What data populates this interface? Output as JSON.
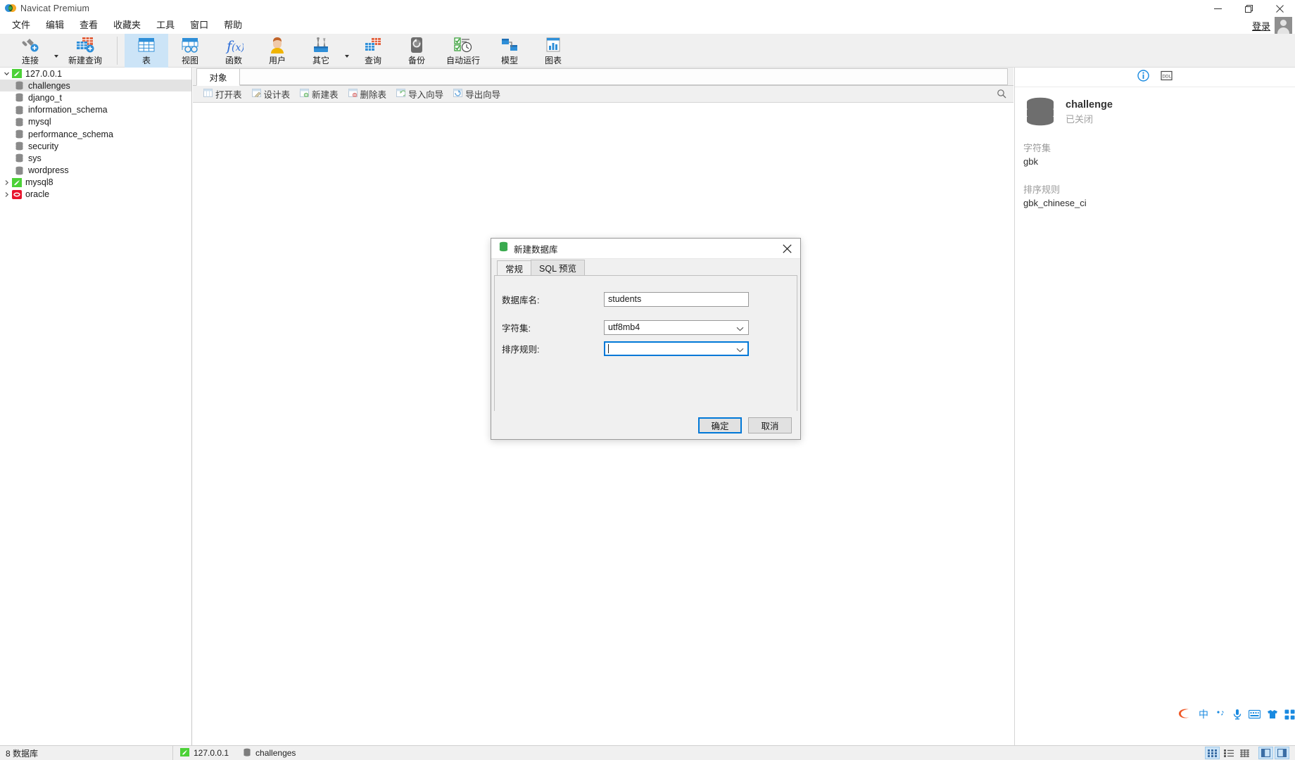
{
  "window": {
    "app_title": "Navicat Premium",
    "minimize": "—",
    "maximize": "❐",
    "close": "✕"
  },
  "menubar": {
    "items": [
      {
        "label": "文件"
      },
      {
        "label": "编辑"
      },
      {
        "label": "查看"
      },
      {
        "label": "收藏夹"
      },
      {
        "label": "工具"
      },
      {
        "label": "窗口"
      },
      {
        "label": "帮助"
      }
    ],
    "login_label": "登录"
  },
  "ribbon": {
    "items": [
      {
        "label": "连接",
        "icon": "connection-icon",
        "caret": true,
        "active": false
      },
      {
        "label": "新建查询",
        "icon": "new-query-icon",
        "caret": false,
        "active": false
      },
      {
        "label": "表",
        "icon": "table-icon",
        "caret": false,
        "active": true
      },
      {
        "label": "视图",
        "icon": "view-icon",
        "caret": false,
        "active": false
      },
      {
        "label": "函数",
        "icon": "function-icon",
        "caret": false,
        "active": false
      },
      {
        "label": "用户",
        "icon": "user-icon",
        "caret": false,
        "active": false
      },
      {
        "label": "其它",
        "icon": "other-tools-icon",
        "caret": true,
        "active": false
      },
      {
        "label": "查询",
        "icon": "query-icon",
        "caret": false,
        "active": false
      },
      {
        "label": "备份",
        "icon": "backup-icon",
        "caret": false,
        "active": false
      },
      {
        "label": "自动运行",
        "icon": "automation-icon",
        "caret": false,
        "active": false
      },
      {
        "label": "模型",
        "icon": "model-icon",
        "caret": false,
        "active": false
      },
      {
        "label": "图表",
        "icon": "chart-icon",
        "caret": false,
        "active": false
      }
    ]
  },
  "sidebar": {
    "connections": [
      {
        "label": "127.0.0.1",
        "icon": "mysql-connection-icon",
        "expanded": true,
        "databases": [
          {
            "label": "challenges",
            "selected": true
          },
          {
            "label": "django_t",
            "selected": false
          },
          {
            "label": "information_schema",
            "selected": false
          },
          {
            "label": "mysql",
            "selected": false
          },
          {
            "label": "performance_schema",
            "selected": false
          },
          {
            "label": "security",
            "selected": false
          },
          {
            "label": "sys",
            "selected": false
          },
          {
            "label": "wordpress",
            "selected": false
          }
        ]
      },
      {
        "label": "mysql8",
        "icon": "mysql-connection-icon",
        "expanded": false,
        "databases": []
      },
      {
        "label": "oracle",
        "icon": "oracle-connection-icon",
        "expanded": false,
        "databases": []
      }
    ]
  },
  "main": {
    "tab_label": "对象",
    "object_toolbar": [
      {
        "label": "打开表",
        "icon": "open-table-icon"
      },
      {
        "label": "设计表",
        "icon": "design-table-icon"
      },
      {
        "label": "新建表",
        "icon": "new-table-icon"
      },
      {
        "label": "删除表",
        "icon": "delete-table-icon"
      },
      {
        "label": "导入向导",
        "icon": "import-wizard-icon"
      },
      {
        "label": "导出向导",
        "icon": "export-wizard-icon"
      }
    ]
  },
  "rightpanel": {
    "info_icon": "info-icon",
    "ddl_icon": "ddl-icon",
    "db_name": "challenge",
    "db_status": "已关闭",
    "charset_label": "字符集",
    "charset_value": "gbk",
    "collation_label": "排序规则",
    "collation_value": "gbk_chinese_ci"
  },
  "dialog": {
    "title": "新建数据库",
    "icon": "database-icon",
    "close_icon": "close-icon",
    "tabs": [
      {
        "label": "常规",
        "active": true
      },
      {
        "label": "SQL 预览",
        "active": false
      }
    ],
    "fields": [
      {
        "label": "数据库名:",
        "value": "students",
        "type": "text"
      },
      {
        "label": "字符集:",
        "value": "utf8mb4",
        "type": "select"
      },
      {
        "label": "排序规则:",
        "value": "",
        "type": "select",
        "focused": true
      }
    ],
    "ok_label": "确定",
    "cancel_label": "取消"
  },
  "statusbar": {
    "db_count": "8 数据库",
    "connection": "127.0.0.1",
    "database": "challenges",
    "view_buttons": [
      {
        "name": "grid-view-icon",
        "selected": true
      },
      {
        "name": "list-view-icon",
        "selected": false
      },
      {
        "name": "detail-view-icon",
        "selected": false
      },
      {
        "name": "left-pane-toggle-icon",
        "selected": true
      },
      {
        "name": "right-pane-toggle-icon",
        "selected": true
      }
    ]
  },
  "ime": {
    "items": [
      {
        "name": "sogou-logo-icon"
      },
      {
        "name": "chinese-mode-icon",
        "glyph": "中"
      },
      {
        "name": "punctuation-icon",
        "glyph": "，"
      },
      {
        "name": "voice-input-icon"
      },
      {
        "name": "soft-keyboard-icon"
      },
      {
        "name": "skin-icon"
      },
      {
        "name": "toolbox-icon"
      }
    ]
  },
  "colors": {
    "accent": "#0078d7",
    "ribbon_active": "#cce4f7",
    "tree_selected": "#e3e3e3",
    "panel_bg": "#f0f0f0"
  }
}
